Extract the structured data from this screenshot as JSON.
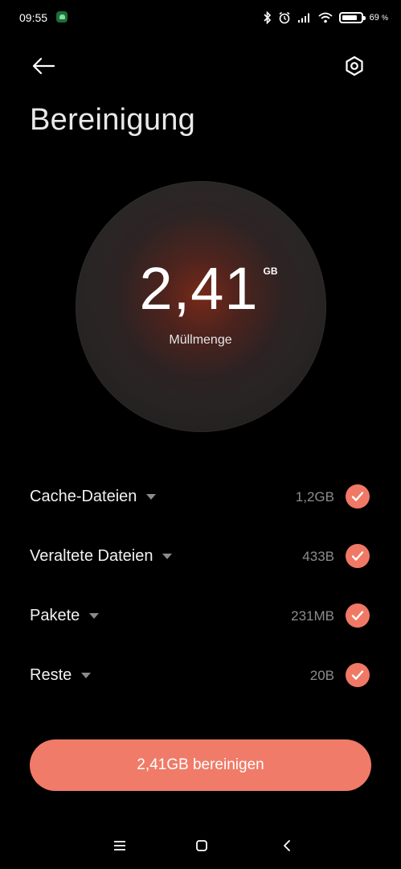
{
  "status_bar": {
    "time": "09:55",
    "battery_percent": "69",
    "battery_unit": "%"
  },
  "header": {
    "title": "Bereinigung",
    "back_icon": "arrow-left-icon",
    "settings_icon": "gear-icon"
  },
  "summary": {
    "amount": "2,41",
    "unit": "GB",
    "label": "Müllmenge"
  },
  "items": [
    {
      "label": "Cache-Dateien",
      "size": "1,2GB",
      "checked": true
    },
    {
      "label": "Veraltete Dateien",
      "size": "433B",
      "checked": true
    },
    {
      "label": "Pakete",
      "size": "231MB",
      "checked": true
    },
    {
      "label": "Reste",
      "size": "20B",
      "checked": true
    }
  ],
  "action": {
    "clean_label": "2,41GB bereinigen"
  },
  "colors": {
    "accent": "#f07b68",
    "background": "#000000",
    "muted_text": "#8c8c8c"
  }
}
